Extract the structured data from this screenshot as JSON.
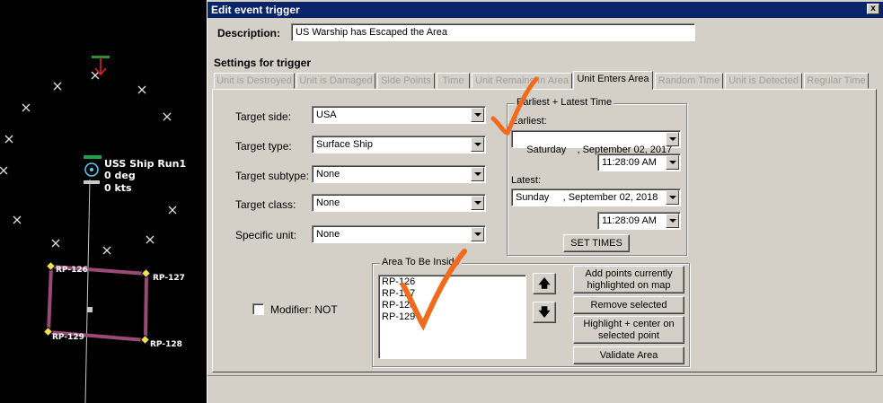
{
  "map": {
    "unit": {
      "name": "USS Ship Run1",
      "heading": "0 deg",
      "speed": "0 kts"
    },
    "reference_points": [
      "RP-126",
      "RP-127",
      "RP-128",
      "RP-129"
    ],
    "colors": {
      "area_line": "#9b4a78",
      "rp_marker": "#f2e24a",
      "track": "#c8c8c8",
      "contact_marker": "#e0e0e0"
    }
  },
  "dialog": {
    "title": "Edit event trigger",
    "close_label": "x",
    "description_label": "Description:",
    "description_value": "US Warship has Escaped the Area",
    "settings_heading": "Settings for trigger",
    "tabs": [
      "Unit is Destroyed",
      "Unit is Damaged",
      "Side Points",
      "Time",
      "Unit Remains In Area",
      "Unit Enters Area",
      "Random Time",
      "Unit is Detected",
      "Regular Time"
    ],
    "active_tab": "Unit Enters Area",
    "fields": {
      "target_side": {
        "label": "Target side:",
        "value": "USA"
      },
      "target_type": {
        "label": "Target type:",
        "value": "Surface Ship"
      },
      "target_subtype": {
        "label": "Target subtype:",
        "value": "None"
      },
      "target_class": {
        "label": "Target class:",
        "value": "None"
      },
      "specific_unit": {
        "label": "Specific unit:",
        "value": "None"
      }
    },
    "time_group": {
      "title": "Earliest + Latest Time",
      "earliest_label": "Earliest:",
      "earliest_date": "Saturday    , September 02, 2017",
      "earliest_time": "11:28:09 AM",
      "latest_label": "Latest:",
      "latest_date": "Sunday     , September 02, 2018",
      "latest_time": "11:28:09 AM",
      "set_times_label": "SET TIMES"
    },
    "area_group": {
      "title": "Area To Be Inside",
      "points": [
        "RP-126",
        "RP-127",
        "RP-128",
        "RP-129"
      ],
      "up_label": "🡅",
      "down_label": "🡇",
      "add_points_label": "Add points currently highlighted on map",
      "remove_label": "Remove selected",
      "highlight_label": "Highlight + center on selected point",
      "validate_label": "Validate Area"
    },
    "modifier_label": "Modifier: NOT",
    "annotation_color": "#f26a1b"
  }
}
